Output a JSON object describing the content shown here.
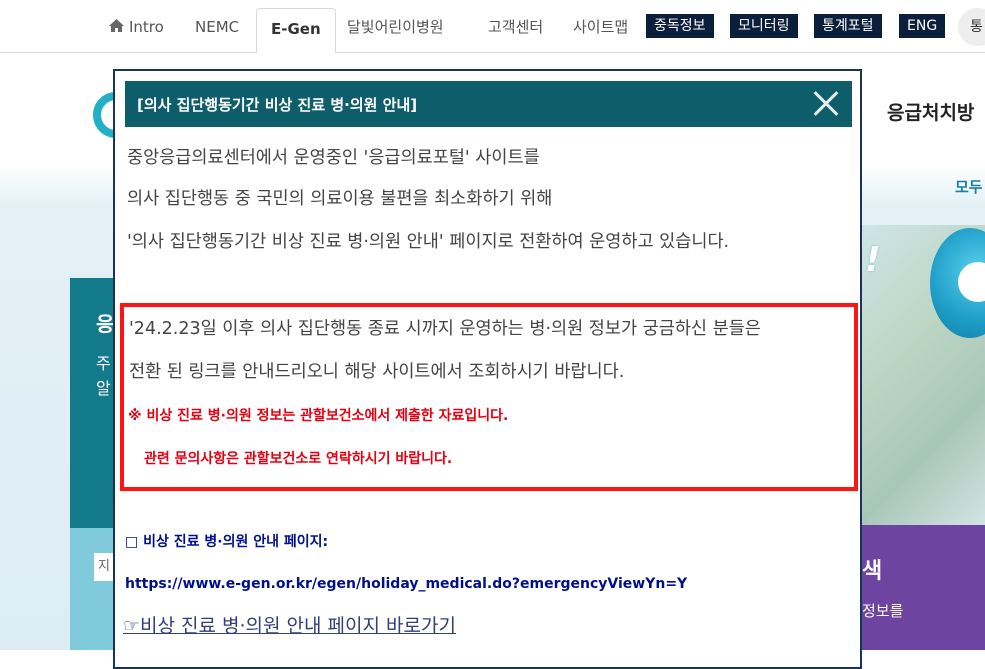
{
  "topnav": {
    "home_icon": "home-icon",
    "items": [
      "Intro",
      "NEMC",
      "E-Gen",
      "달빛어린이병원",
      "고객센터",
      "사이트맵"
    ],
    "active": "E-Gen",
    "buttons": [
      "중독정보",
      "모니터링",
      "통계포털",
      "ENG"
    ],
    "circle_label": "통"
  },
  "background": {
    "header_title": "응급처치방",
    "right_top": "모두",
    "left_heading": "응",
    "left_line1": "주",
    "left_line2": "알",
    "left_input": "지",
    "purple_title": "색",
    "purple_sub": "정보를",
    "exclaim": "!"
  },
  "popup": {
    "title": "[의사 집단행동기간 비상 진료 병·의원 안내]",
    "intro": [
      "중앙응급의료센터에서 운영중인 '응급의료포털' 사이트를",
      "의사 집단행동 중 국민의 의료이용 불편을 최소화하기 위해",
      "'의사 집단행동기간 비상 진료 병·의원 안내' 페이지로 전환하여 운영하고 있습니다."
    ],
    "notice_lines": [
      "'24.2.23일 이후 의사 집단행동 종료 시까지 운영하는 병·의원 정보가 궁금하신 분들은",
      "전환 된 링크를 안내드리오니 해당 사이트에서 조회하시기 바랍니다."
    ],
    "notice_red": [
      "※ 비상 진료 병·의원 정보는 관할보건소에서 제출한 자료입니다.",
      "관련 문의사항은 관할보건소로 연락하시기 바랍니다."
    ],
    "link_heading": "□ 비상 진료 병·의원 안내 페이지:",
    "link_url": "https://www.e-gen.or.kr/egen/holiday_medical.do?emergencyViewYn=Y",
    "link_go": "☞비상 진료 병·의원 안내 페이지 바로가기"
  },
  "colors": {
    "popup_header": "#0e5d6b",
    "notice_border": "#ff1414",
    "notice_red_text": "#e60012",
    "link_blue": "#000f8f",
    "nav_button": "#0b1e3b"
  }
}
